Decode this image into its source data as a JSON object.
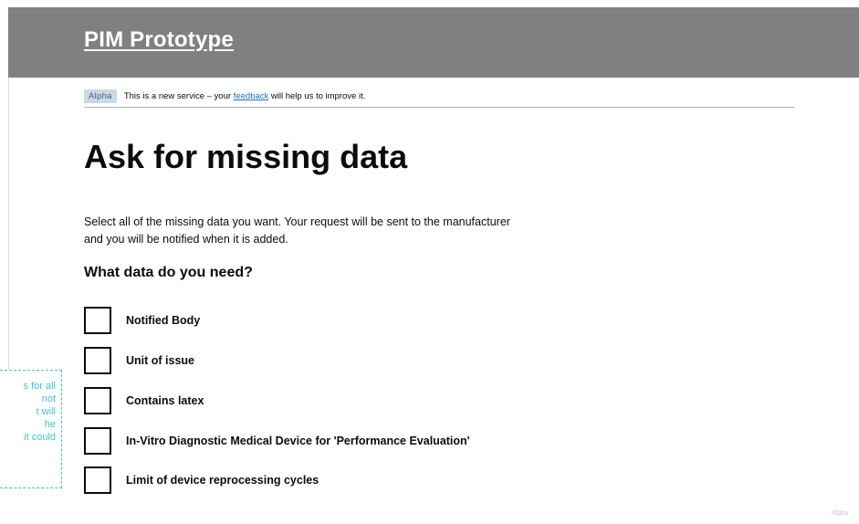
{
  "header": {
    "title": "PIM Prototype"
  },
  "phase_banner": {
    "tag": "Alpha",
    "text_before": "This is a new service – your ",
    "link": "feedback",
    "text_after": " will help us to improve it."
  },
  "main": {
    "heading": "Ask for missing data",
    "intro": "Select all of the missing data you want. Your request will be sent to the manufacturer and you will be notified when it is added.",
    "question": "What data do you need?",
    "options": [
      {
        "label": "Notified Body",
        "checked": false
      },
      {
        "label": "Unit of issue",
        "checked": false
      },
      {
        "label": "Contains latex",
        "checked": false
      },
      {
        "label": "In-Vitro Diagnostic Medical Device for 'Performance Evaluation'",
        "checked": false
      },
      {
        "label": "Limit of device reprocessing cycles",
        "checked": false
      }
    ]
  },
  "annotation": {
    "text": "s for all\n not\nt will\nhe\nit could"
  },
  "watermark": {
    "text": "Alpha"
  },
  "colors": {
    "header_bg": "#808080",
    "link": "#1d70b8",
    "annotation": "#3ec5d4",
    "text": "#0b0c0c"
  }
}
